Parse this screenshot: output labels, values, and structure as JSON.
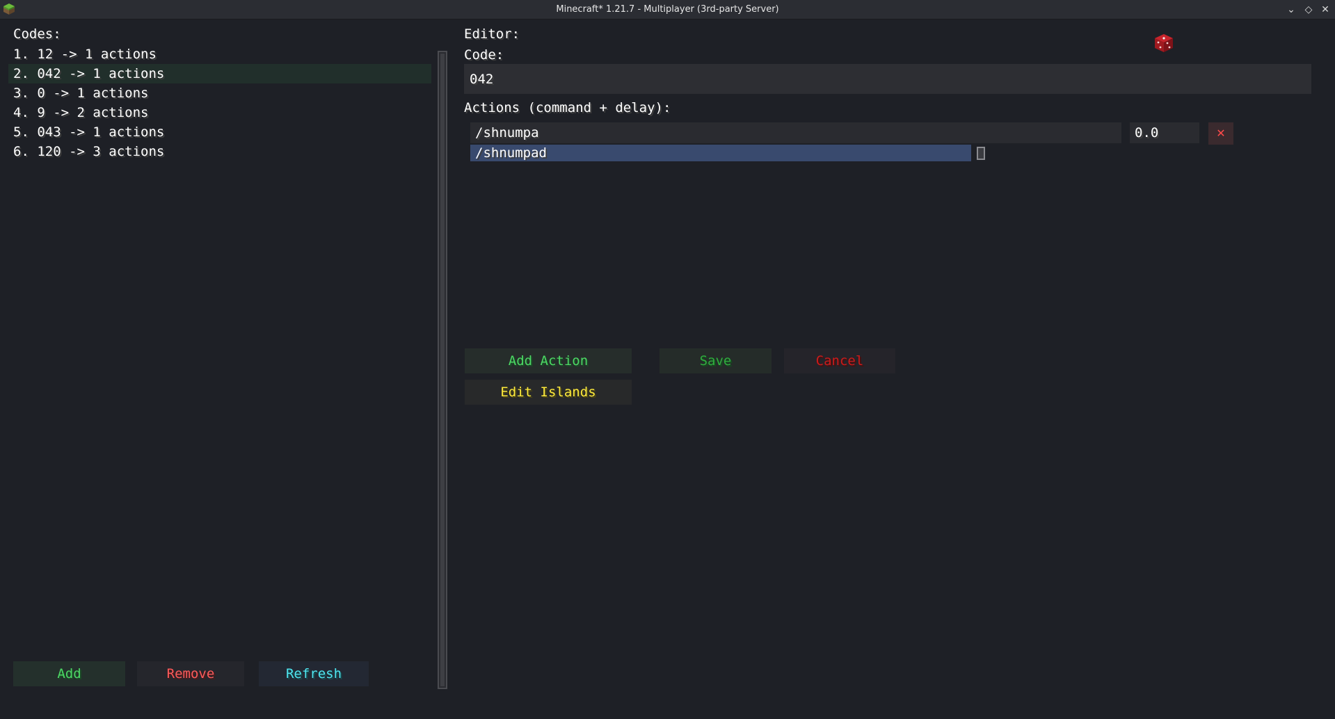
{
  "window": {
    "title": "Minecraft* 1.21.7 - Multiplayer (3rd-party Server)",
    "controls": {
      "minimize": "⌄",
      "maximize": "◇",
      "close": "✕"
    }
  },
  "codes": {
    "label": "Codes:",
    "items": [
      {
        "text": "1. 12 -> 1 actions"
      },
      {
        "text": "2. 042 -> 1 actions"
      },
      {
        "text": "3. 0 -> 1 actions"
      },
      {
        "text": "4. 9 -> 2 actions"
      },
      {
        "text": "5. 043 -> 1 actions"
      },
      {
        "text": "6. 120 -> 3 actions"
      }
    ],
    "selected_index": 1,
    "buttons": {
      "add": "Add",
      "remove": "Remove",
      "refresh": "Refresh"
    }
  },
  "editor": {
    "label": "Editor:",
    "code_label": "Code:",
    "code_value": "042",
    "actions_label": "Actions (command + delay):",
    "actions": [
      {
        "command": "/shnumpa",
        "delay": "0.0",
        "delete_icon": "✕"
      },
      {
        "command": "/shnumpad"
      }
    ],
    "buttons": {
      "add_action": "Add Action",
      "save": "Save",
      "cancel": "Cancel",
      "edit_islands": "Edit Islands"
    }
  },
  "colors": {
    "add": "#4cd964",
    "remove": "#ff5a5a",
    "refresh": "#4fe6f0",
    "save": "#2fae3e",
    "cancel": "#cc1a1a",
    "edit_islands": "#ffeb3b",
    "selected_row": "#212f2b",
    "selected_input": "#394a6e"
  }
}
